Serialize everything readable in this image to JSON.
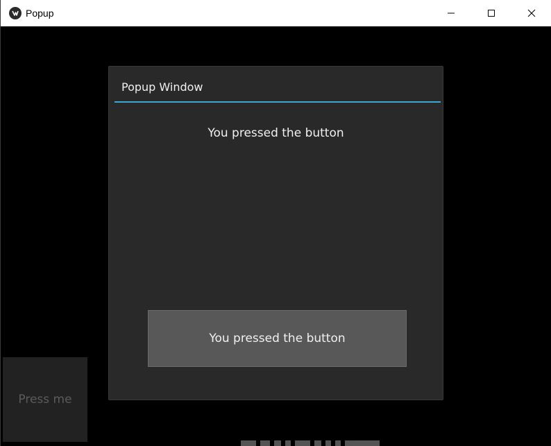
{
  "window": {
    "title": "Popup",
    "app_icon": "kivy-logo-icon",
    "controls": [
      "minimize-icon",
      "maximize-icon",
      "close-icon"
    ]
  },
  "main": {
    "press_button_label": "Press me"
  },
  "popup": {
    "title": "Popup Window",
    "message": "You pressed the button",
    "button_label": "You pressed the button",
    "accent_color": "#3da6da"
  },
  "colors": {
    "background": "#000000",
    "popup_background": "#292929",
    "button_background": "#585858",
    "press_me_background": "#222222"
  }
}
